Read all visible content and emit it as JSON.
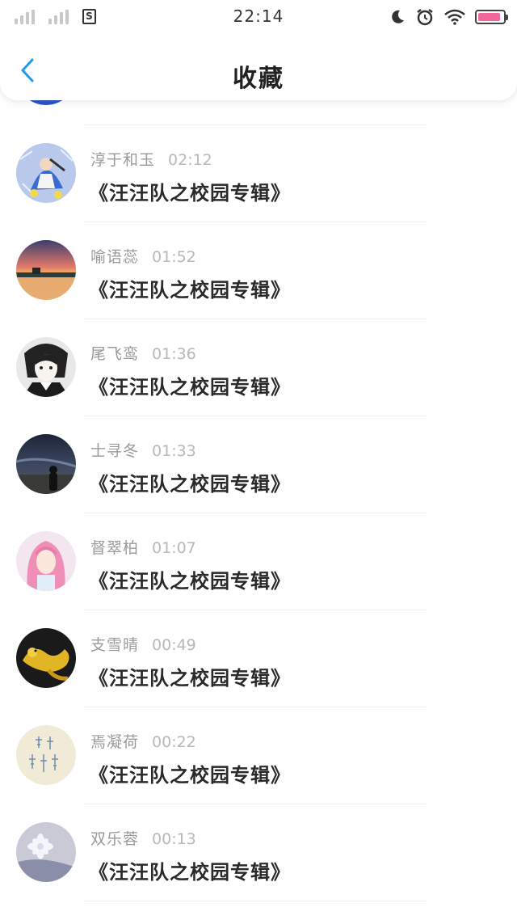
{
  "status_bar": {
    "time": "22:14",
    "battery_level": 0.9,
    "icons": [
      "signal-icon",
      "signal-icon",
      "sim-card-icon",
      "moon-icon",
      "alarm-icon",
      "wifi-icon",
      "battery-icon"
    ],
    "sim_label": "S"
  },
  "nav": {
    "back_icon": "chevron-left-icon",
    "title": "收藏"
  },
  "colors": {
    "accent": "#1e9bf0",
    "battery": "#f2679b"
  },
  "items": [
    {
      "name": "淳于和玉",
      "time": "02:12",
      "title": "《汪汪队之校园专辑》",
      "avatar": "anime-character-avatar"
    },
    {
      "name": "喻语蕊",
      "time": "01:52",
      "title": "《汪汪队之校园专辑》",
      "avatar": "sunset-lake-avatar"
    },
    {
      "name": "尾飞鸾",
      "time": "01:36",
      "title": "《汪汪队之校园专辑》",
      "avatar": "anime-boy-avatar"
    },
    {
      "name": "士寻冬",
      "time": "01:33",
      "title": "《汪汪队之校园专辑》",
      "avatar": "night-sky-avatar"
    },
    {
      "name": "督翠柏",
      "time": "01:07",
      "title": "《汪汪队之校园专辑》",
      "avatar": "pink-hair-girl-avatar"
    },
    {
      "name": "支雪晴",
      "time": "00:49",
      "title": "《汪汪队之校园专辑》",
      "avatar": "golden-dragon-avatar"
    },
    {
      "name": "焉凝荷",
      "time": "00:22",
      "title": "《汪汪队之校园专辑》",
      "avatar": "calligraphy-avatar"
    },
    {
      "name": "双乐蓉",
      "time": "00:13",
      "title": "《汪汪队之校园专辑》",
      "avatar": "white-flower-avatar"
    }
  ]
}
